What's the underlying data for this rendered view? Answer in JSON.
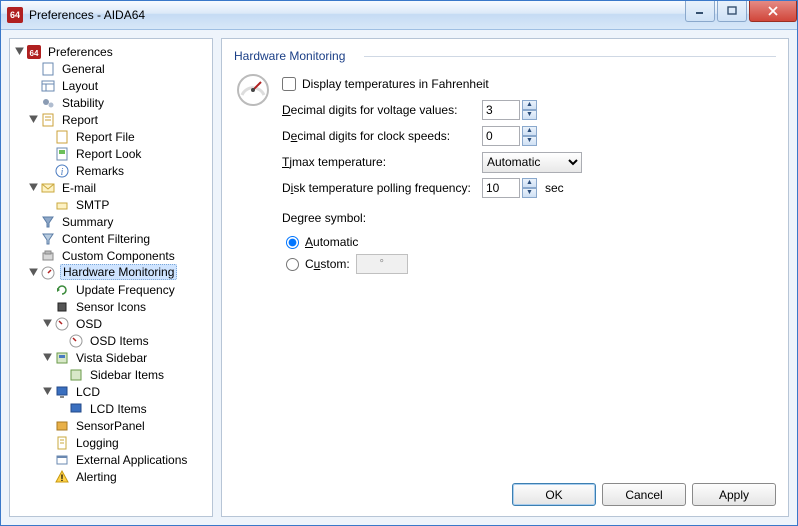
{
  "window": {
    "title": "Preferences - AIDA64"
  },
  "sidebar": {
    "root": "Preferences",
    "items": {
      "general": "General",
      "layout": "Layout",
      "stability": "Stability",
      "report": "Report",
      "report_file": "Report File",
      "report_look": "Report Look",
      "remarks": "Remarks",
      "email": "E-mail",
      "smtp": "SMTP",
      "summary": "Summary",
      "content_filtering": "Content Filtering",
      "custom_components": "Custom Components",
      "hw_mon": "Hardware Monitoring",
      "update_freq": "Update Frequency",
      "sensor_icons": "Sensor Icons",
      "osd": "OSD",
      "osd_items": "OSD Items",
      "vista_sidebar": "Vista Sidebar",
      "sidebar_items": "Sidebar Items",
      "lcd": "LCD",
      "lcd_items": "LCD Items",
      "sensorpanel": "SensorPanel",
      "logging": "Logging",
      "ext_apps": "External Applications",
      "alerting": "Alerting"
    }
  },
  "main": {
    "heading": "Hardware Monitoring",
    "fahrenheit_label": "Display temperatures in Fahrenheit",
    "fahrenheit_checked": false,
    "voltage_label_pre": "Decimal digits for voltage values:",
    "voltage_value": "3",
    "clock_label_pre": "Decimal digits for clock speeds:",
    "clock_value": "0",
    "tjmax_label_pre": "Tjmax temperature:",
    "tjmax_value": "Automatic",
    "disk_label_pre": "Disk temperature polling frequency:",
    "disk_value": "10",
    "disk_unit": "sec",
    "degree_heading": "Degree symbol:",
    "degree_auto": "Automatic",
    "degree_custom": "Custom:",
    "degree_selected": "automatic",
    "degree_custom_value": "°"
  },
  "footer": {
    "ok": "OK",
    "cancel": "Cancel",
    "apply": "Apply"
  }
}
